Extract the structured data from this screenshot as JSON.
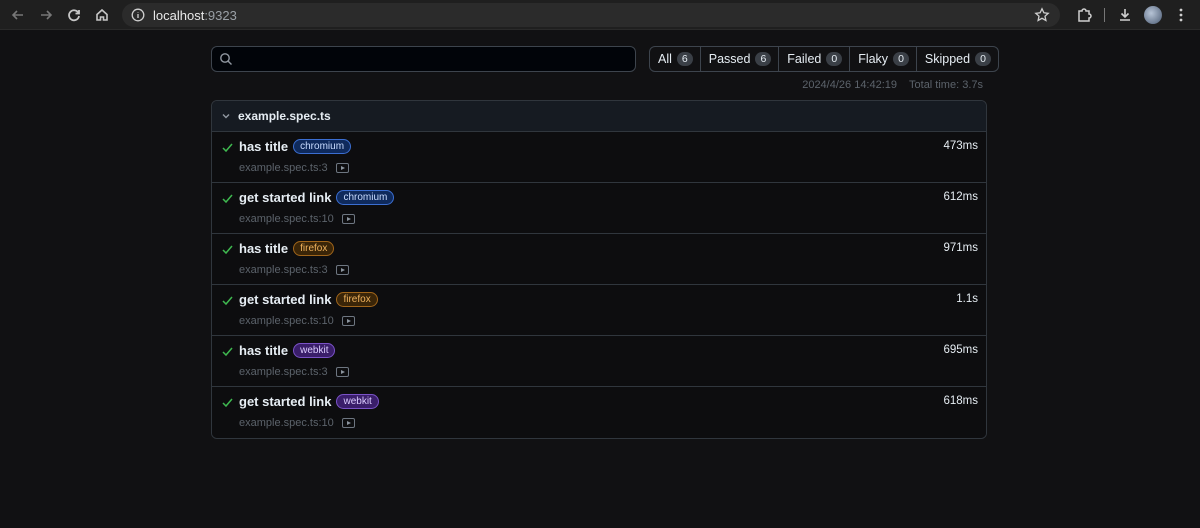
{
  "browser": {
    "url_host": "localhost",
    "url_port": ":9323"
  },
  "filters": [
    {
      "label": "All",
      "count": "6"
    },
    {
      "label": "Passed",
      "count": "6"
    },
    {
      "label": "Failed",
      "count": "0"
    },
    {
      "label": "Flaky",
      "count": "0"
    },
    {
      "label": "Skipped",
      "count": "0"
    }
  ],
  "meta": {
    "timestamp": "2024/4/26 14:42:19",
    "total_time": "Total time: 3.7s"
  },
  "file": {
    "title": "example.spec.ts",
    "tests": [
      {
        "name": "has title",
        "project": "chromium",
        "duration": "473ms",
        "location": "example.spec.ts:3"
      },
      {
        "name": "get started link",
        "project": "chromium",
        "duration": "612ms",
        "location": "example.spec.ts:10"
      },
      {
        "name": "has title",
        "project": "firefox",
        "duration": "971ms",
        "location": "example.spec.ts:3"
      },
      {
        "name": "get started link",
        "project": "firefox",
        "duration": "1.1s",
        "location": "example.spec.ts:10"
      },
      {
        "name": "has title",
        "project": "webkit",
        "duration": "695ms",
        "location": "example.spec.ts:3"
      },
      {
        "name": "get started link",
        "project": "webkit",
        "duration": "618ms",
        "location": "example.spec.ts:10"
      }
    ]
  },
  "colors": {
    "passed": "#3fb950",
    "chromium": "#3b6ed1",
    "firefox": "#a0651a",
    "webkit": "#7a52c7"
  }
}
